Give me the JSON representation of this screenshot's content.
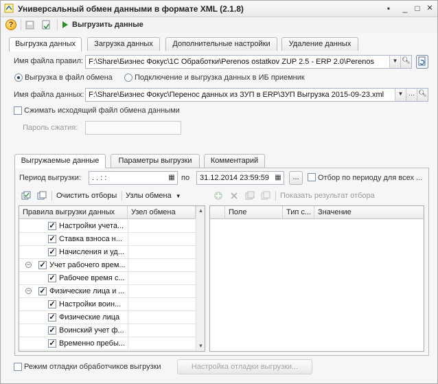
{
  "window": {
    "title": "Универсальный обмен данными в формате XML (2.1.8)",
    "minimize": "_",
    "maximize": "□",
    "close": "×"
  },
  "toolbar": {
    "help": "?",
    "run_label": "Выгрузить данные"
  },
  "main_tabs": [
    {
      "label": "Выгрузка данных",
      "active": true
    },
    {
      "label": "Загрузка данных",
      "active": false
    },
    {
      "label": "Дополнительные настройки",
      "active": false
    },
    {
      "label": "Удаление данных",
      "active": false
    }
  ],
  "rules_file": {
    "label": "Имя файла правил:",
    "value": "F:\\Share\\Бизнес Фокус\\1С Обработки\\Perenos ostatkov ZUP 2.5 - ERP 2.0\\Perenos"
  },
  "export_mode": {
    "option_file": "Выгрузка в файл обмена",
    "option_ib": "Подключение и выгрузка данных в ИБ приемник"
  },
  "data_file": {
    "label": "Имя файла данных:",
    "value": "F:\\Share\\Бизнес Фокус\\Перенос данных из ЗУП в ERP\\ЗУП Выгрузка 2015-09-23.xml"
  },
  "compress": {
    "label": "Сжимать исходящий файл обмена данными",
    "password_label": "Пароль сжатия:"
  },
  "inner_tabs": [
    {
      "label": "Выгружаемые данные",
      "active": true
    },
    {
      "label": "Параметры выгрузки",
      "active": false
    },
    {
      "label": "Комментарий",
      "active": false
    }
  ],
  "period": {
    "label": "Период выгрузки:",
    "from": " .  .       :  :",
    "to_label": "по",
    "to": "31.12.2014 23:59:59",
    "more": "...",
    "filter_label": "Отбор по периоду для всех ..."
  },
  "left_toolbar": {
    "clear_filters": "Очистить отборы",
    "exchange_nodes": "Узлы обмена"
  },
  "right_toolbar": {
    "show_result": "Показать результат отбора"
  },
  "rules_grid": {
    "columns": [
      "Правила выгрузки данных",
      "Узел обмена"
    ],
    "rows": [
      {
        "label": "Настройки учета...",
        "level": 1,
        "checked": true,
        "expander": ""
      },
      {
        "label": "Ставка взноса н...",
        "level": 1,
        "checked": true,
        "expander": ""
      },
      {
        "label": "Начисления и уд...",
        "level": 1,
        "checked": true,
        "expander": ""
      },
      {
        "label": "Учет рабочего врем...",
        "level": 0,
        "checked": true,
        "expander": "−"
      },
      {
        "label": "Рабочее время с...",
        "level": 1,
        "checked": true,
        "expander": ""
      },
      {
        "label": "Физические лица и ...",
        "level": 0,
        "checked": true,
        "expander": "−"
      },
      {
        "label": "Настройки воин...",
        "level": 1,
        "checked": true,
        "expander": ""
      },
      {
        "label": "Физические лица",
        "level": 1,
        "checked": true,
        "expander": ""
      },
      {
        "label": "Воинский учет ф...",
        "level": 1,
        "checked": true,
        "expander": ""
      },
      {
        "label": "Временно пребы...",
        "level": 1,
        "checked": true,
        "expander": ""
      }
    ]
  },
  "filter_grid": {
    "columns": [
      "Поле",
      "Тип с...",
      "Значение"
    ]
  },
  "debug": {
    "label": "Режим отладки обработчиков выгрузки",
    "button": "Настройка отладки выгрузки..."
  }
}
